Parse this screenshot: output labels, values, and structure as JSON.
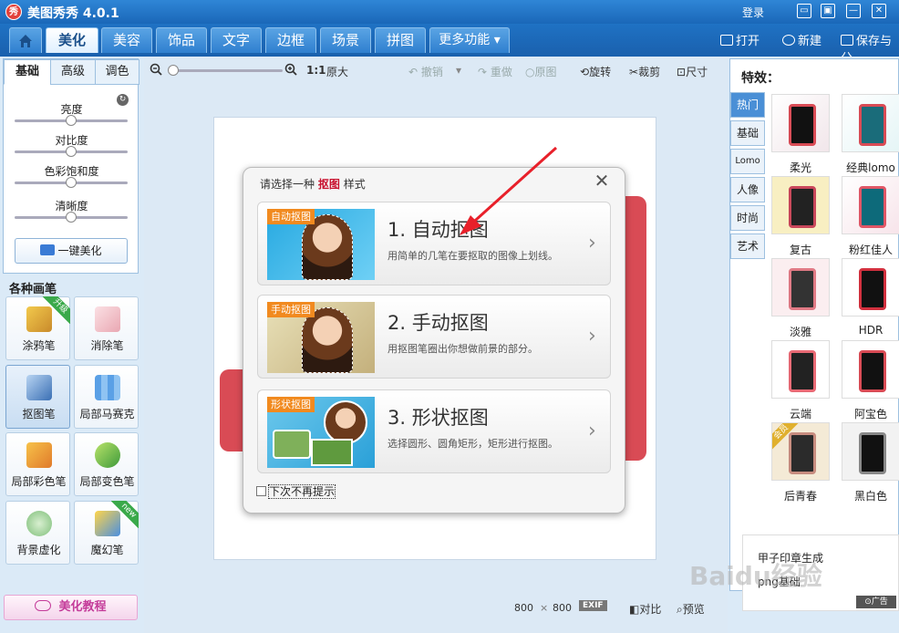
{
  "app": {
    "logo_text": "秀",
    "title": "美图秀秀 4.0.1",
    "login": "登录"
  },
  "menubar": {
    "tabs": [
      {
        "label": ""
      },
      {
        "label": "美化"
      },
      {
        "label": "美容"
      },
      {
        "label": "饰品"
      },
      {
        "label": "文字"
      },
      {
        "label": "边框"
      },
      {
        "label": "场景"
      },
      {
        "label": "拼图"
      },
      {
        "label": "更多功能 ▾"
      }
    ],
    "open": "打开",
    "new": "新建",
    "save": "保存与分"
  },
  "left": {
    "tabs": [
      "基础",
      "高级",
      "调色"
    ],
    "sliders": [
      {
        "label": "亮度",
        "value": 0.5
      },
      {
        "label": "对比度",
        "value": 0.5
      },
      {
        "label": "色彩饱和度",
        "value": 0.5
      },
      {
        "label": "清晰度",
        "value": 0.5
      }
    ],
    "one_click": "一键美化",
    "brushes_title": "各种画笔",
    "tools": [
      {
        "label": "涂鸦笔",
        "badge": "升级"
      },
      {
        "label": "消除笔"
      },
      {
        "label": "抠图笔"
      },
      {
        "label": "局部马赛克"
      },
      {
        "label": "局部彩色笔"
      },
      {
        "label": "局部变色笔"
      },
      {
        "label": "背景虚化"
      },
      {
        "label": "魔幻笔",
        "badge": "new"
      }
    ],
    "tutorial": "美化教程"
  },
  "toolbar": {
    "ratio": "1:1",
    "original_size": "原大",
    "undo": "撤销",
    "redo": "重做",
    "original": "原图",
    "rotate": "旋转",
    "crop": "裁剪",
    "size": "尺寸"
  },
  "dialog": {
    "title_prefix": "请选择一种",
    "title_emph": "抠图",
    "title_suffix": "样式",
    "options": [
      {
        "badge": "自动抠图",
        "heading": "1. 自动抠图",
        "desc": "用简单的几笔在要抠取的图像上划线。"
      },
      {
        "badge": "手动抠图",
        "heading": "2. 手动抠图",
        "desc": "用抠图笔圈出你想做前景的部分。"
      },
      {
        "badge": "形状抠图",
        "heading": "3. 形状抠图",
        "desc": "选择圆形、圆角矩形，矩形进行抠图。"
      }
    ],
    "dont_show": "下次不再提示"
  },
  "footer": {
    "width": "800",
    "x": "×",
    "height": "800",
    "exif": "EXIF",
    "compare": "对比",
    "preview": "预览"
  },
  "right": {
    "title": "特效：",
    "categories": [
      "热门",
      "基础",
      "Lomo",
      "人像",
      "时尚",
      "艺术"
    ],
    "effects": [
      "柔光",
      "经典lomo",
      "复古",
      "粉红佳人",
      "淡雅",
      "HDR",
      "云端",
      "阿宝色",
      "后青春",
      "黑白色"
    ],
    "special_badge": "会员",
    "ad_line1": "甲子印章生成",
    "ad_line2": "png基础",
    "ad_tag": "广告"
  },
  "watermark": "Baidu经验",
  "colors": {
    "accent": "#1a67b8",
    "phone": "#d94b55",
    "badge": "#f18a1f",
    "arrow": "#e8202a"
  }
}
